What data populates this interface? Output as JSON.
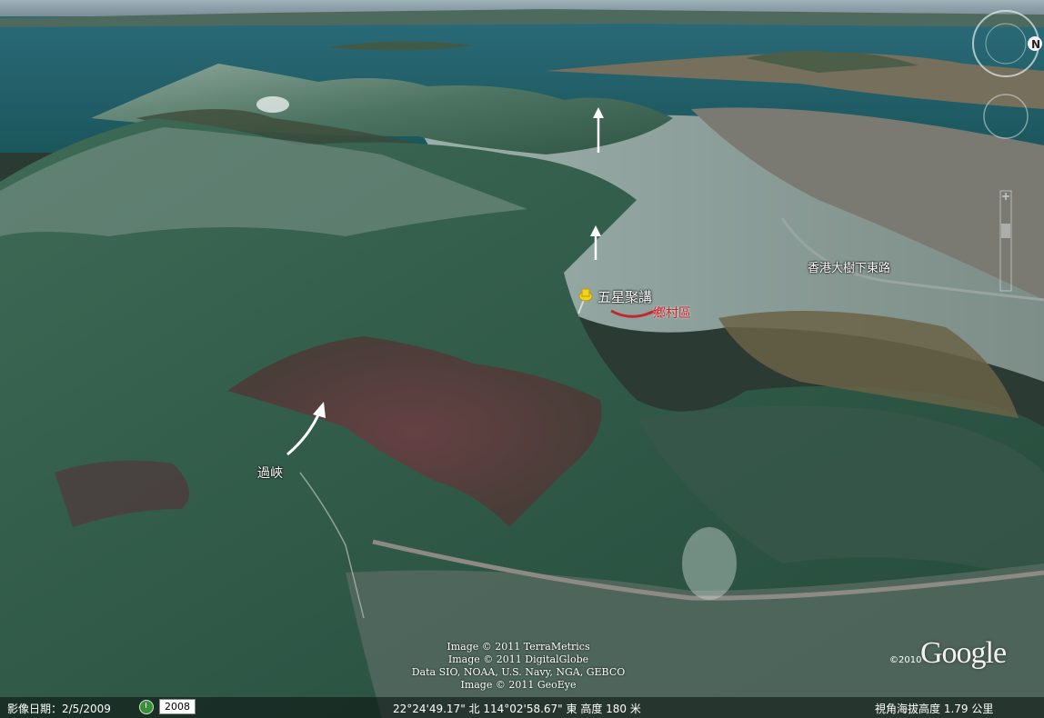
{
  "labels": {
    "pagoda": "五星聚講",
    "village": "鄉村區",
    "road": "香港大樹下東路",
    "pass": "過峽"
  },
  "credits": [
    "Image © 2011 TerraMetrics",
    "Image © 2011 DigitalGlobe",
    "Data SIO, NOAA, U.S. Navy, NGA, GEBCO",
    "Image © 2011 GeoEye"
  ],
  "google": {
    "logo": "Google",
    "year": "©2010"
  },
  "status": {
    "date": "影像日期：2/5/2009",
    "year_button": "2008",
    "coords": "22°24'49.17\" 北 114°02'58.67\" 東 高度  180 米",
    "eye": "視角海拔高度    1.79 公里"
  },
  "nav": {
    "north": "N"
  },
  "colors": {
    "sea": "#1c5b63",
    "forest": "#2f5a47",
    "urban": "#8fa3a0",
    "burn": "#5a3437",
    "village_curve": "#c2272d",
    "pin": "#f2d21b"
  }
}
